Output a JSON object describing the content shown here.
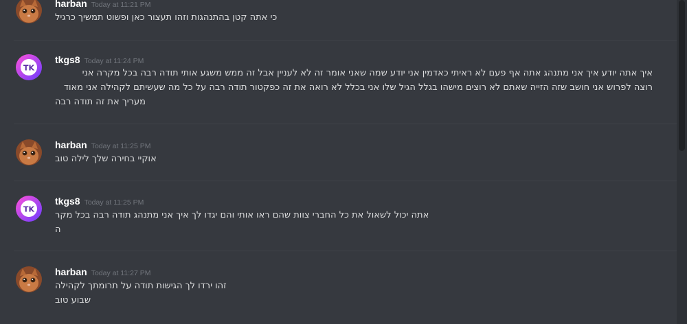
{
  "colors": {
    "background": "#36393f",
    "username": "#ffffff",
    "timestamp": "#72767d",
    "text": "#dcddde"
  },
  "messages": [
    {
      "username": "harban",
      "timestamp": "Today at 11:21 PM",
      "avatar_icon": "kitten-avatar-icon",
      "lines": [
        "כי אתה קטן בהתנהגות וזהו תעצור כאן ופשוט תמשיך כרגיל"
      ]
    },
    {
      "username": "tkgs8",
      "timestamp": "Today at 11:24 PM",
      "avatar_icon": "tk-avatar-icon",
      "lines": [
        "איך אתה יודע איך אני מתנהג אתה אף פעם לא ראיתי כאדמין אני יודע שמה שאני אומר זה לא לעניין אבל זה ממש משגע אותי תודה רבה בכל מקרה אני",
        "רוצה לפרוש אני חושב שזה הזייה שאתם לא רוצים מישהו בגלל הגיל שלו אני בכלל לא רואה את זה כפקטור תודה רבה על כל מה שעשיתם לקהילה אני מאוד",
        "מעריך את זה תודה רבה"
      ]
    },
    {
      "username": "harban",
      "timestamp": "Today at 11:25 PM",
      "avatar_icon": "kitten-avatar-icon",
      "lines": [
        "אוקיי בחירה שלך לילה טוב"
      ]
    },
    {
      "username": "tkgs8",
      "timestamp": "Today at 11:25 PM",
      "avatar_icon": "tk-avatar-icon",
      "lines": [
        "אתה יכול לשאול את כל החברי צוות שהם ראו אותי והם יגדו לך איך אני מתנהג תודה רבה בכל מקר",
        "ה"
      ]
    },
    {
      "username": "harban",
      "timestamp": "Today at 11:27 PM",
      "avatar_icon": "kitten-avatar-icon",
      "lines": [
        "זהו ירדו לך הגישות תודה על תרומתך לקהילה",
        "שבוע טוב"
      ]
    }
  ]
}
